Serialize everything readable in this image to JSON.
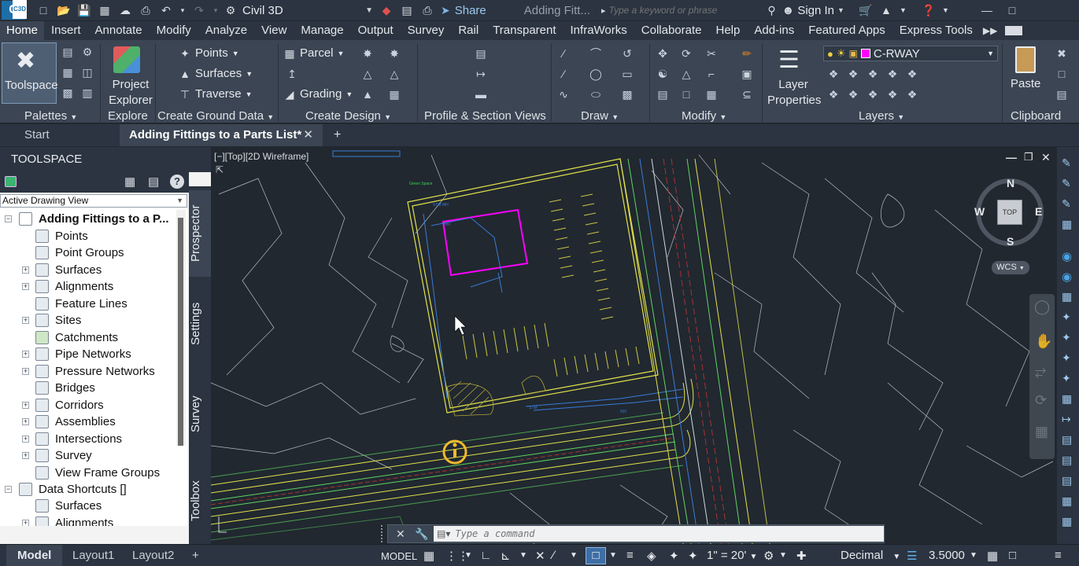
{
  "titlebar": {
    "app_button": "C",
    "app_badge": "C3D",
    "workspace": "Civil 3D",
    "share": "Share",
    "doc_title": "Adding Fitt...",
    "search_placeholder": "Type a keyword or phrase",
    "sign_in": "Sign In"
  },
  "menu_tabs": [
    "Home",
    "Insert",
    "Annotate",
    "Modify",
    "Analyze",
    "View",
    "Manage",
    "Output",
    "Survey",
    "Rail",
    "Transparent",
    "InfraWorks",
    "Collaborate",
    "Help",
    "Add-ins",
    "Featured Apps",
    "Express Tools"
  ],
  "ribbon": {
    "toolspace": "Toolspace",
    "project_explorer": "Project Explorer",
    "points": "Points",
    "surfaces": "Surfaces",
    "traverse": "Traverse",
    "parcel": "Parcel",
    "grading": "Grading",
    "layer_properties": "Layer Properties",
    "layer_name": "C-RWAY",
    "paste": "Paste",
    "panels": {
      "palettes": "Palettes",
      "explore": "Explore",
      "create_ground_data": "Create Ground Data",
      "create_design": "Create Design",
      "profile_section_views": "Profile & Section Views",
      "draw": "Draw",
      "modify": "Modify",
      "layers": "Layers",
      "clipboard": "Clipboard"
    }
  },
  "file_tabs": {
    "start": "Start",
    "active": "Adding Fittings to a Parts List*"
  },
  "toolspace": {
    "title": "TOOLSPACE",
    "view_select": "Active Drawing View",
    "root": "Adding Fittings to a P...",
    "items": [
      "Points",
      "Point Groups",
      "Surfaces",
      "Alignments",
      "Feature Lines",
      "Sites",
      "Catchments",
      "Pipe Networks",
      "Pressure Networks",
      "Bridges",
      "Corridors",
      "Assemblies",
      "Intersections",
      "Survey",
      "View Frame Groups"
    ],
    "data_shortcuts": "Data Shortcuts []",
    "ds_items": [
      "Surfaces",
      "Alignments"
    ],
    "vtabs": [
      "Prospector",
      "Settings",
      "Survey",
      "Toolbox"
    ]
  },
  "viewport": {
    "label": "[−][Top][2D Wireframe]",
    "compass": {
      "n": "N",
      "s": "S",
      "e": "E",
      "w": "W",
      "top": "TOP"
    },
    "wcs": "WCS",
    "site_label": "Green Space"
  },
  "command": {
    "placeholder": "Type a command"
  },
  "statusbar": {
    "tabs": [
      "Model",
      "Layout1",
      "Layout2"
    ],
    "model": "MODEL",
    "scale": "1\" = 20'",
    "units": "Decimal",
    "elevation": "3.5000"
  },
  "colors": {
    "accent_layer": "#ff00ff",
    "drawing_bg": "#212830",
    "panel": "#3b4553",
    "frame": "#2b3440"
  }
}
